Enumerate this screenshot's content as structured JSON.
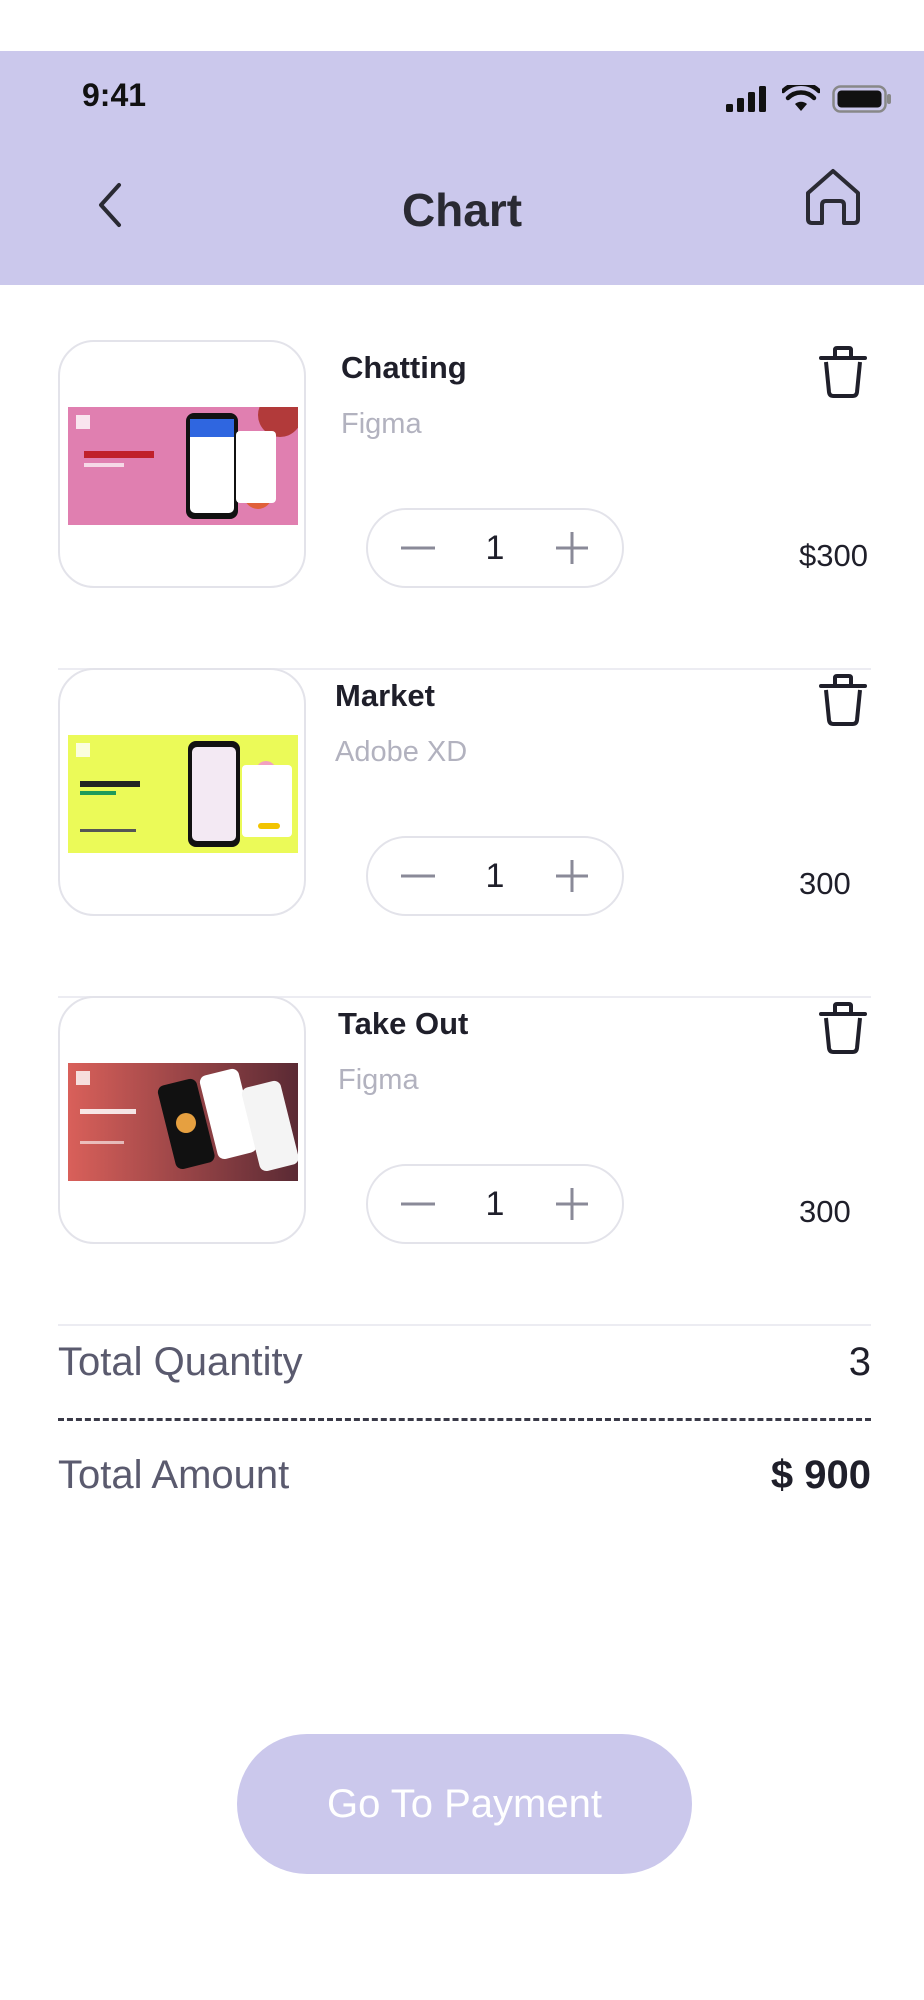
{
  "status_bar": {
    "time": "9:41",
    "icons": [
      "signal-icon",
      "wifi-icon",
      "battery-icon"
    ]
  },
  "header": {
    "title": "Chart",
    "back_icon": "chevron-left-icon",
    "home_icon": "home-icon"
  },
  "items": [
    {
      "name": "Chatting",
      "tool": "Figma",
      "quantity": "1",
      "price": "$300",
      "thumb_color": "#e07fb0",
      "minus": "−",
      "plus": "+"
    },
    {
      "name": "Market",
      "tool": "Adobe XD",
      "quantity": "1",
      "price": "300",
      "thumb_color": "#ebfa58",
      "minus": "−",
      "plus": "+"
    },
    {
      "name": "Take Out",
      "tool": "Figma",
      "quantity": "1",
      "price": "300",
      "thumb_color": "#b34a4a",
      "minus": "−",
      "plus": "+"
    }
  ],
  "totals": {
    "quantity_label": "Total Quantity",
    "quantity_value": "3",
    "amount_label": "Total Amount",
    "amount_value": "$ 900"
  },
  "payment": {
    "label": "Go To Payment"
  },
  "colors": {
    "accent": "#cbc8ec",
    "text": "#1f1f2a",
    "muted": "#b2b2bf"
  }
}
